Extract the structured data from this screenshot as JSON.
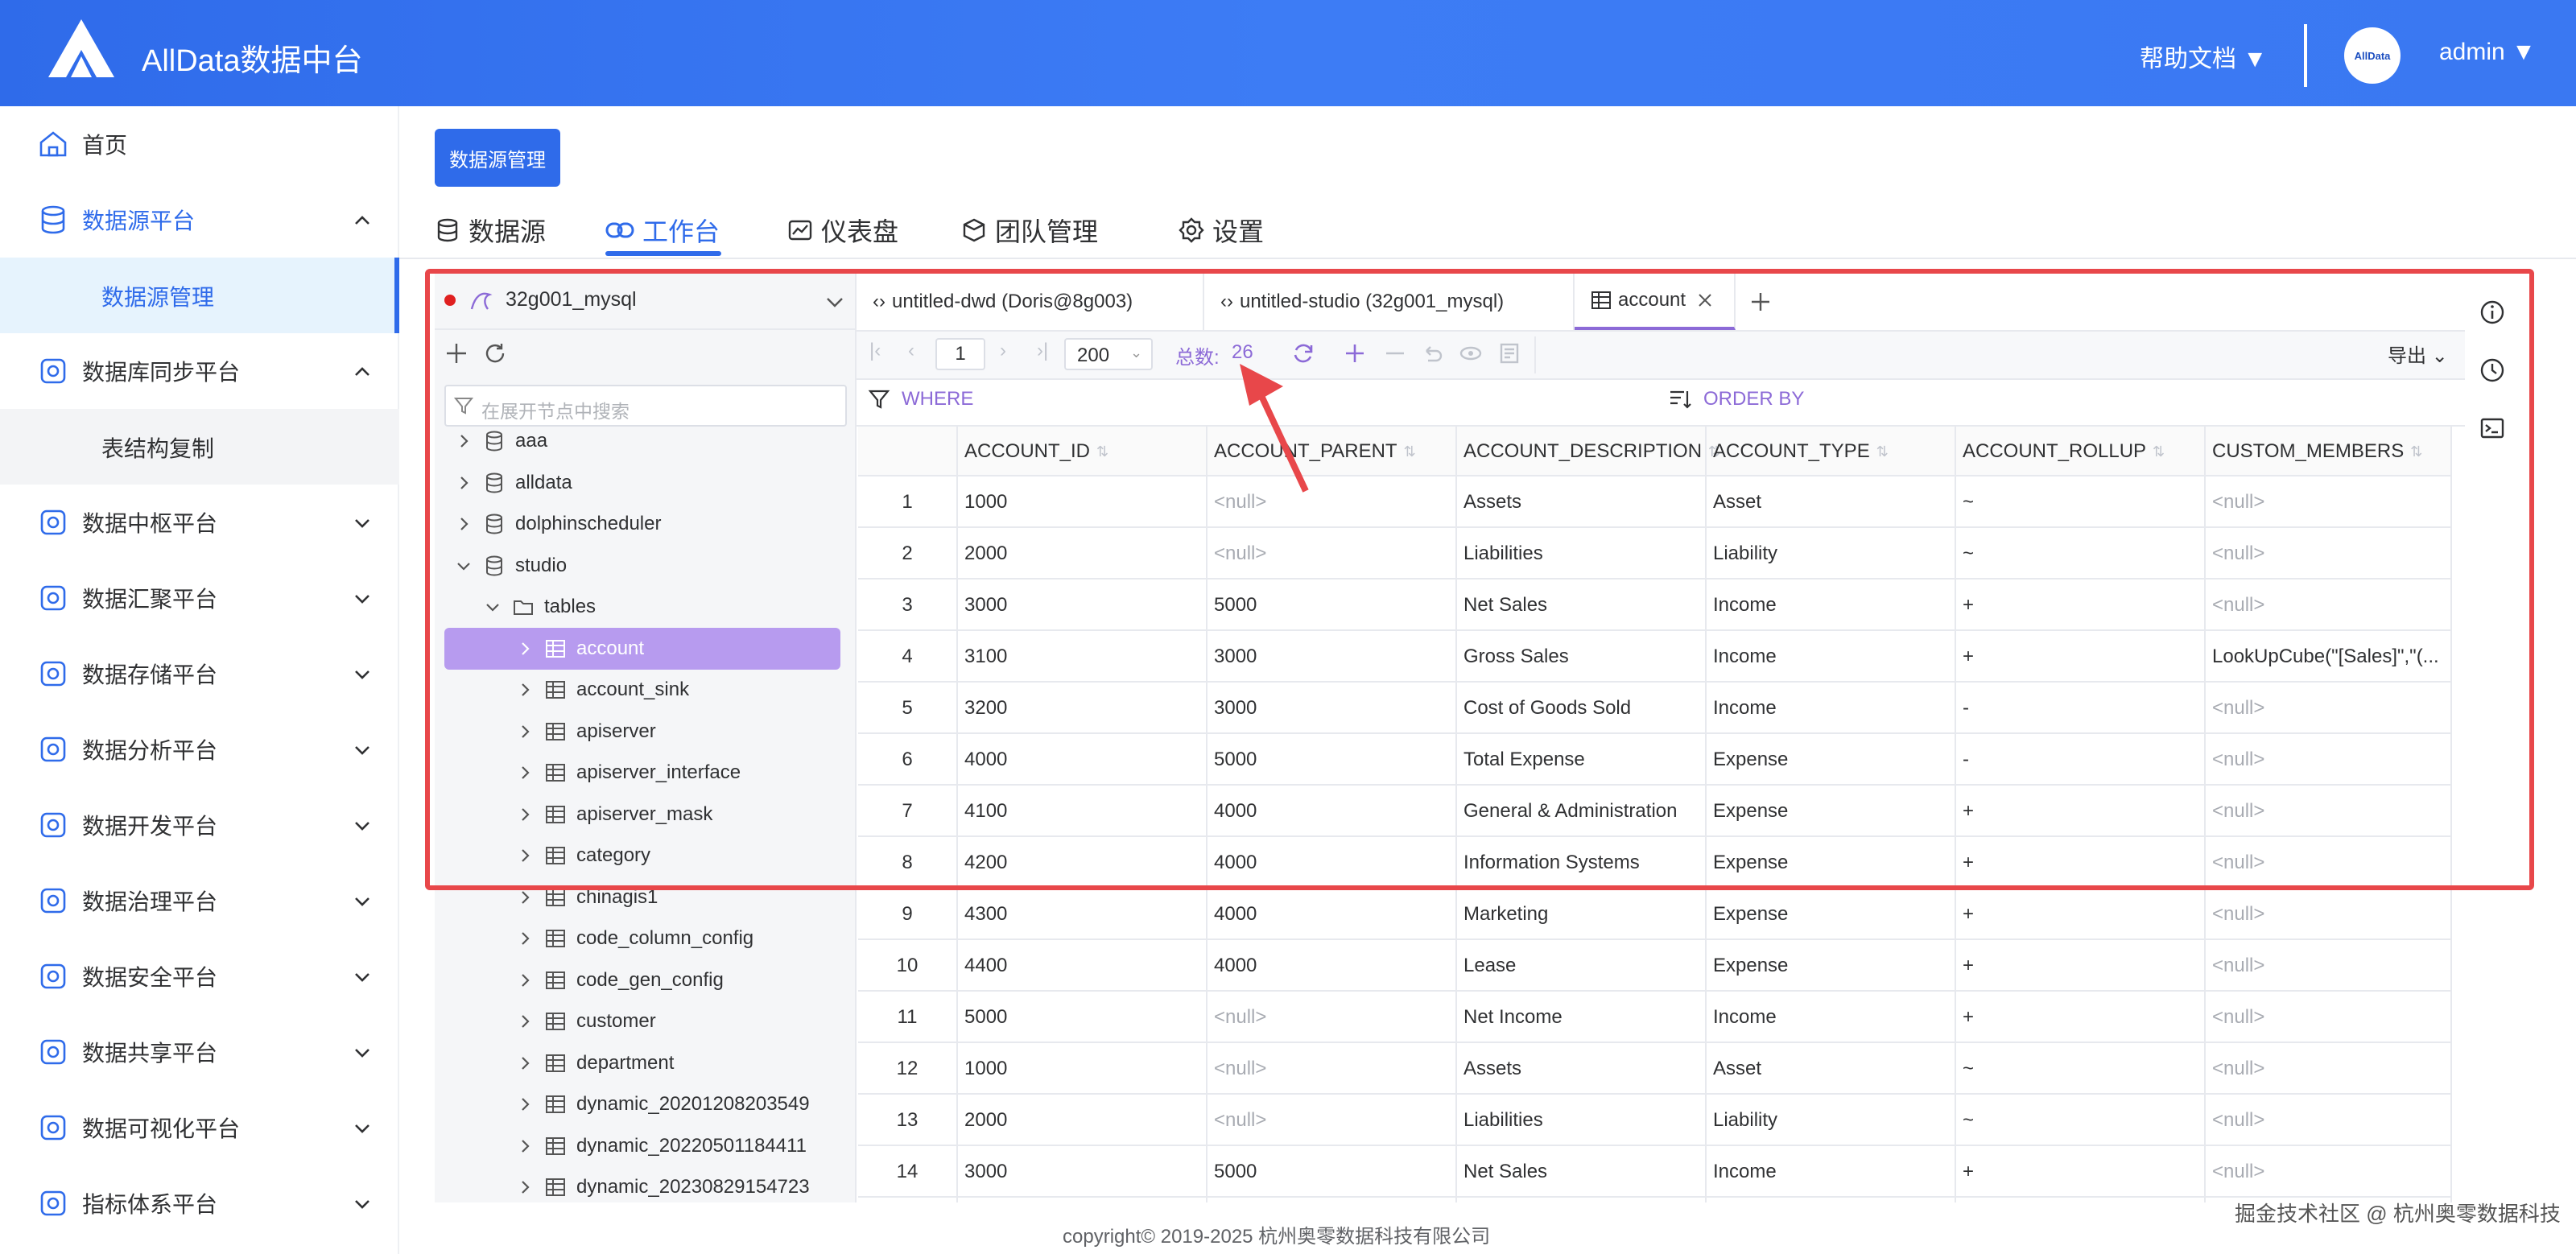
{
  "header": {
    "brand": "AllData数据中台",
    "help": "帮助文档",
    "avatar_text": "AllData",
    "user": "admin"
  },
  "sidebar": {
    "items": [
      {
        "label": "首页",
        "icon": "home-icon"
      },
      {
        "label": "数据源平台",
        "icon": "database-icon"
      },
      {
        "label": "数据源管理",
        "sub": true,
        "selected": true
      },
      {
        "label": "数据库同步平台",
        "icon": "sync-icon"
      },
      {
        "label": "表结构复制",
        "sub": true
      },
      {
        "label": "数据中枢平台",
        "icon": "grid-icon"
      },
      {
        "label": "数据汇聚平台",
        "icon": "layers-icon"
      },
      {
        "label": "数据存储平台",
        "icon": "storage-icon"
      },
      {
        "label": "数据分析平台",
        "icon": "analysis-icon"
      },
      {
        "label": "数据开发平台",
        "icon": "dev-icon"
      },
      {
        "label": "数据治理平台",
        "icon": "govern-icon"
      },
      {
        "label": "数据安全平台",
        "icon": "security-icon"
      },
      {
        "label": "数据共享平台",
        "icon": "share-icon"
      },
      {
        "label": "数据可视化平台",
        "icon": "bi-icon"
      },
      {
        "label": "指标体系平台",
        "icon": "metric-icon"
      }
    ]
  },
  "main": {
    "top_button": "数据源管理",
    "tabs": [
      "数据源",
      "工作台",
      "仪表盘",
      "团队管理",
      "设置"
    ],
    "datasource_select": "32g001_mysql",
    "search_placeholder": "在展开节点中搜索",
    "tree": [
      {
        "label": "aaa",
        "type": "db"
      },
      {
        "label": "alldata",
        "type": "db"
      },
      {
        "label": "dolphinscheduler",
        "type": "db"
      },
      {
        "label": "studio",
        "type": "db",
        "expanded": true
      },
      {
        "label": "tables",
        "type": "folder",
        "expanded": true
      },
      {
        "label": "account",
        "type": "table",
        "selected": true
      },
      {
        "label": "account_sink",
        "type": "table"
      },
      {
        "label": "apiserver",
        "type": "table"
      },
      {
        "label": "apiserver_interface",
        "type": "table"
      },
      {
        "label": "apiserver_mask",
        "type": "table"
      },
      {
        "label": "category",
        "type": "table"
      },
      {
        "label": "chinagis1",
        "type": "table"
      },
      {
        "label": "code_column_config",
        "type": "table"
      },
      {
        "label": "code_gen_config",
        "type": "table"
      },
      {
        "label": "customer",
        "type": "table"
      },
      {
        "label": "department",
        "type": "table"
      },
      {
        "label": "dynamic_20201208203549",
        "type": "table"
      },
      {
        "label": "dynamic_20220501184411",
        "type": "table"
      },
      {
        "label": "dynamic_20230829154723",
        "type": "table"
      }
    ],
    "editor_tabs": [
      "untitled-dwd (Doris@8g003)",
      "untitled-studio (32g001_mysql)",
      "account"
    ],
    "toolbar": {
      "page": "1",
      "page_size": "200",
      "total_label": "总数:",
      "total": "26",
      "export": "导出"
    },
    "where": "WHERE",
    "order_by": "ORDER BY",
    "columns": [
      "ACCOUNT_ID",
      "ACCOUNT_PARENT",
      "ACCOUNT_DESCRIPTION",
      "ACCOUNT_TYPE",
      "ACCOUNT_ROLLUP",
      "CUSTOM_MEMBERS"
    ],
    "rows": [
      [
        "1",
        "1000",
        "<null>",
        "Assets",
        "Asset",
        "~",
        "<null>"
      ],
      [
        "2",
        "2000",
        "<null>",
        "Liabilities",
        "Liability",
        "~",
        "<null>"
      ],
      [
        "3",
        "3000",
        "5000",
        "Net Sales",
        "Income",
        "+",
        "<null>"
      ],
      [
        "4",
        "3100",
        "3000",
        "Gross Sales",
        "Income",
        "+",
        "LookUpCube(\"[Sales]\",\"(..."
      ],
      [
        "5",
        "3200",
        "3000",
        "Cost of Goods Sold",
        "Income",
        "-",
        "<null>"
      ],
      [
        "6",
        "4000",
        "5000",
        "Total Expense",
        "Expense",
        "-",
        "<null>"
      ],
      [
        "7",
        "4100",
        "4000",
        "General & Administration",
        "Expense",
        "+",
        "<null>"
      ],
      [
        "8",
        "4200",
        "4000",
        "Information Systems",
        "Expense",
        "+",
        "<null>"
      ],
      [
        "9",
        "4300",
        "4000",
        "Marketing",
        "Expense",
        "+",
        "<null>"
      ],
      [
        "10",
        "4400",
        "4000",
        "Lease",
        "Expense",
        "+",
        "<null>"
      ],
      [
        "11",
        "5000",
        "<null>",
        "Net Income",
        "Income",
        "+",
        "<null>"
      ],
      [
        "12",
        "1000",
        "<null>",
        "Assets",
        "Asset",
        "~",
        "<null>"
      ],
      [
        "13",
        "2000",
        "<null>",
        "Liabilities",
        "Liability",
        "~",
        "<null>"
      ],
      [
        "14",
        "3000",
        "5000",
        "Net Sales",
        "Income",
        "+",
        "<null>"
      ]
    ]
  },
  "footer": "copyright© 2019-2025 杭州奥零数据科技有限公司",
  "watermark": "掘金技术社区 @ 杭州奥零数据科技",
  "colors": {
    "primary": "#2f6bea",
    "purple": "#8c6ad7",
    "highlight": "#e8474a"
  }
}
